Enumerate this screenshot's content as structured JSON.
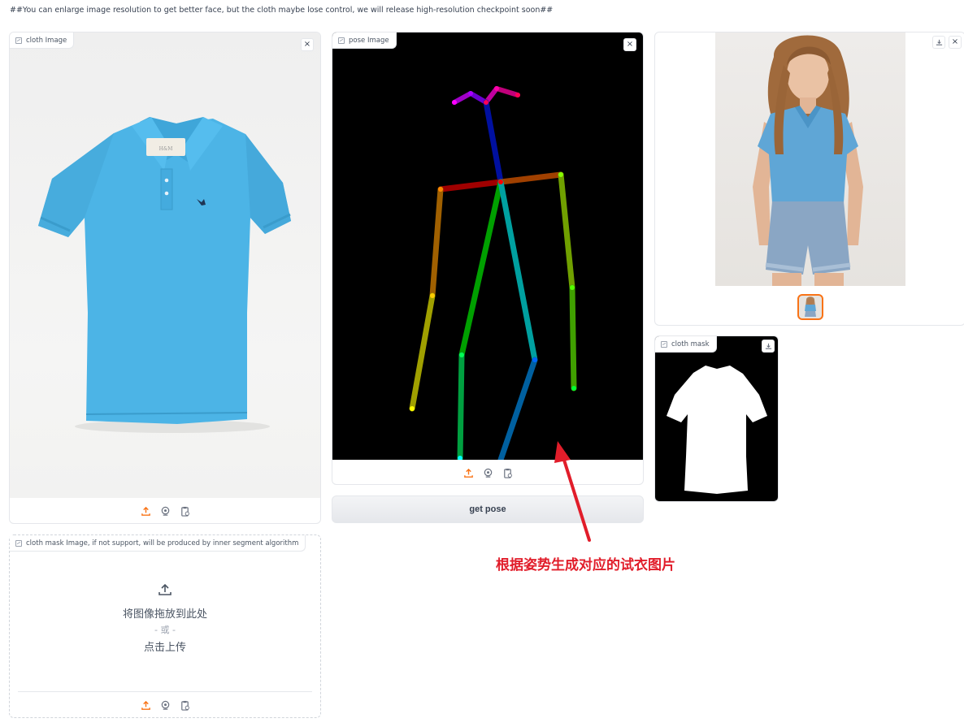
{
  "notice": "##You can enlarge image resolution to get better face, but the cloth maybe lose control, we will release high-resolution checkpoint soon##",
  "cloth_image": {
    "label": "cloth Image",
    "icon": "image-icon"
  },
  "pose_image": {
    "label": "pose Image",
    "icon": "image-icon"
  },
  "cloth_mask_input": {
    "label": "cloth mask Image, if not support, will be produced by inner segment algorithm",
    "drop_text": "将图像拖放到此处",
    "or_text": "- 或 -",
    "click_text": "点击上传"
  },
  "output_gallery": {
    "icon": "image-icon"
  },
  "cloth_mask_output": {
    "label": "cloth mask"
  },
  "get_pose_button": "get pose",
  "annotation_text": "根据姿势生成对应的试衣图片",
  "close_glyph": "×",
  "colors": {
    "accent": "#f97316",
    "annotation": "#e11d2a",
    "shirt": "#4cb4e6",
    "pose_bg": "#000000"
  },
  "toolbar_icons": [
    "upload-icon",
    "webcam-icon",
    "clipboard-icon"
  ]
}
